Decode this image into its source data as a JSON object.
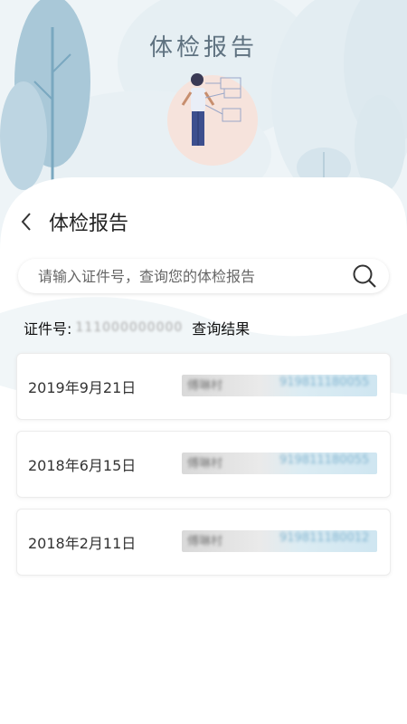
{
  "hero": {
    "title": "体检报告"
  },
  "header": {
    "title": "体检报告"
  },
  "search": {
    "placeholder": "请输入证件号，查询您的体检报告"
  },
  "id_line": {
    "label": "证件号:",
    "value": "111000000000",
    "result_label": "查询结果"
  },
  "records": [
    {
      "date": "2019年9月21日",
      "name": "傅琳村",
      "number": "919811180055"
    },
    {
      "date": "2018年6月15日",
      "name": "傅琳村",
      "number": "919811180055"
    },
    {
      "date": "2018年2月11日",
      "name": "傅琳村",
      "number": "919811180012"
    }
  ],
  "colors": {
    "accent": "#7fb3cf",
    "title": "#5f7280",
    "card_border": "#ececec"
  }
}
